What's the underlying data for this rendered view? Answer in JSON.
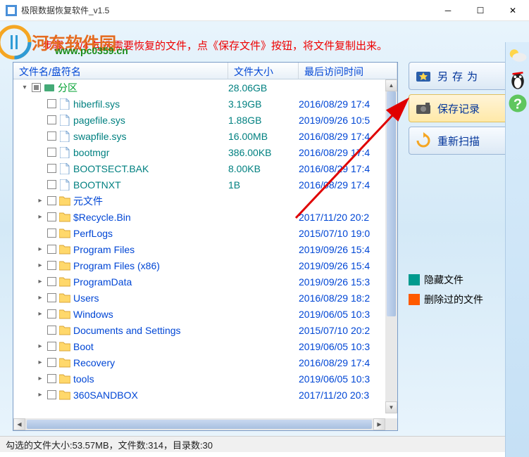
{
  "window": {
    "title": "极限数据恢复软件_v1.5"
  },
  "watermark": {
    "brand": "河东软件园",
    "url": "www.pc0359.cn"
  },
  "instruction": "步骤：3/4 勾选需要恢复的文件，点《保存文件》按钮，将文件复制出来。",
  "columns": {
    "name": "文件名/盘符名",
    "size": "文件大小",
    "time": "最后访问时间"
  },
  "rows": [
    {
      "indent": 0,
      "exp": "▾",
      "chk": "partial",
      "ico": "disk",
      "name": "分区",
      "cls": "partition-green",
      "size": "28.06GB",
      "time": ""
    },
    {
      "indent": 1,
      "exp": "",
      "chk": "",
      "ico": "file",
      "name": "hiberfil.sys",
      "cls": "fname-teal",
      "size": "3.19GB",
      "time": "2016/08/29 17:4"
    },
    {
      "indent": 1,
      "exp": "",
      "chk": "",
      "ico": "file",
      "name": "pagefile.sys",
      "cls": "fname-teal",
      "size": "1.88GB",
      "time": "2019/09/26 10:5"
    },
    {
      "indent": 1,
      "exp": "",
      "chk": "",
      "ico": "file",
      "name": "swapfile.sys",
      "cls": "fname-teal",
      "size": "16.00MB",
      "time": "2016/08/29 17:4"
    },
    {
      "indent": 1,
      "exp": "",
      "chk": "",
      "ico": "file",
      "name": "bootmgr",
      "cls": "fname-teal",
      "size": "386.00KB",
      "time": "2016/08/29 17:4"
    },
    {
      "indent": 1,
      "exp": "",
      "chk": "",
      "ico": "file",
      "name": "BOOTSECT.BAK",
      "cls": "fname-teal",
      "size": "8.00KB",
      "time": "2016/08/29 17:4"
    },
    {
      "indent": 1,
      "exp": "",
      "chk": "",
      "ico": "file",
      "name": "BOOTNXT",
      "cls": "fname-teal",
      "size": "1B",
      "time": "2016/08/29 17:4"
    },
    {
      "indent": 1,
      "exp": "▸",
      "chk": "",
      "ico": "folder",
      "name": "元文件",
      "cls": "fname-blue",
      "size": "",
      "time": ""
    },
    {
      "indent": 1,
      "exp": "▸",
      "chk": "",
      "ico": "folder",
      "name": "$Recycle.Bin",
      "cls": "fname-blue",
      "size": "",
      "time": "2017/11/20 20:2"
    },
    {
      "indent": 1,
      "exp": "",
      "chk": "",
      "ico": "folder",
      "name": "PerfLogs",
      "cls": "fname-blue",
      "size": "",
      "time": "2015/07/10 19:0"
    },
    {
      "indent": 1,
      "exp": "▸",
      "chk": "",
      "ico": "folder",
      "name": "Program Files",
      "cls": "fname-blue",
      "size": "",
      "time": "2019/09/26 15:4"
    },
    {
      "indent": 1,
      "exp": "▸",
      "chk": "",
      "ico": "folder",
      "name": "Program Files (x86)",
      "cls": "fname-blue",
      "size": "",
      "time": "2019/09/26 15:4"
    },
    {
      "indent": 1,
      "exp": "▸",
      "chk": "",
      "ico": "folder",
      "name": "ProgramData",
      "cls": "fname-blue",
      "size": "",
      "time": "2019/09/26 15:3"
    },
    {
      "indent": 1,
      "exp": "▸",
      "chk": "",
      "ico": "folder",
      "name": "Users",
      "cls": "fname-blue",
      "size": "",
      "time": "2016/08/29 18:2"
    },
    {
      "indent": 1,
      "exp": "▸",
      "chk": "",
      "ico": "folder",
      "name": "Windows",
      "cls": "fname-blue",
      "size": "",
      "time": "2019/06/05 10:3"
    },
    {
      "indent": 1,
      "exp": "",
      "chk": "",
      "ico": "folder",
      "name": "Documents and Settings",
      "cls": "fname-blue",
      "size": "",
      "time": "2015/07/10 20:2"
    },
    {
      "indent": 1,
      "exp": "▸",
      "chk": "",
      "ico": "folder",
      "name": "Boot",
      "cls": "fname-blue",
      "size": "",
      "time": "2019/06/05 10:3"
    },
    {
      "indent": 1,
      "exp": "▸",
      "chk": "",
      "ico": "folder",
      "name": "Recovery",
      "cls": "fname-blue",
      "size": "",
      "time": "2016/08/29 17:4"
    },
    {
      "indent": 1,
      "exp": "▸",
      "chk": "",
      "ico": "folder",
      "name": "tools",
      "cls": "fname-blue",
      "size": "",
      "time": "2019/06/05 10:3"
    },
    {
      "indent": 1,
      "exp": "▸",
      "chk": "",
      "ico": "folder",
      "name": "360SANDBOX",
      "cls": "fname-blue",
      "size": "",
      "time": "2017/11/20 20:3"
    }
  ],
  "buttons": {
    "save_as": "另存为",
    "save_record": "保存记录",
    "rescan": "重新扫描"
  },
  "legend": {
    "hidden": "隐藏文件",
    "deleted": "删除过的文件",
    "hidden_color": "#009a8e",
    "deleted_color": "#ff5a00"
  },
  "status": "勾选的文件大小:53.57MB，文件数:314，目录数:30"
}
